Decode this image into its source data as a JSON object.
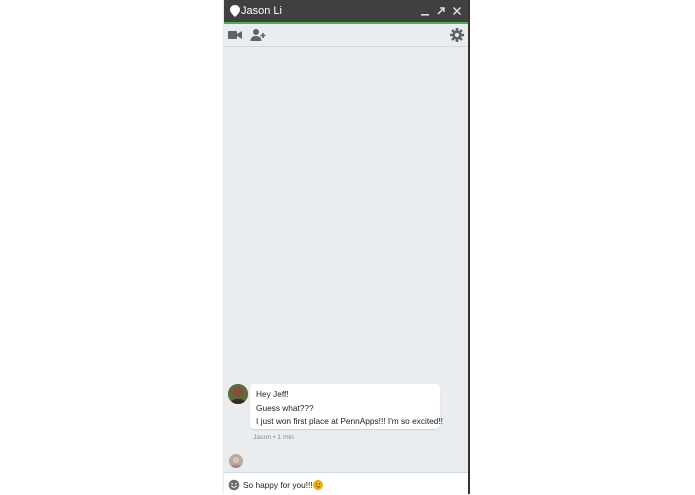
{
  "window": {
    "title": "Jason Li"
  },
  "toolbar": {
    "video": "video-camera",
    "add_person": "add-person",
    "settings": "gear"
  },
  "messages": [
    {
      "sender": "Jason",
      "lines": [
        "Hey Jeff!",
        "Guess what???",
        "I just won first place at PennApps!!! I'm so excited!!"
      ],
      "meta": "Jason • 1 min"
    }
  ],
  "compose": {
    "text": "So happy for you!!!"
  },
  "colors": {
    "titlebar": "#404040",
    "accent": "#4caf50",
    "background": "#e9edf0"
  }
}
